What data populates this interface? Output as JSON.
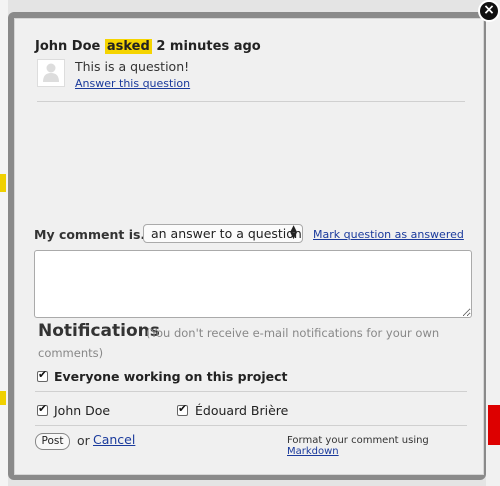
{
  "question": {
    "author": "John Doe",
    "action": "asked",
    "time": "2 minutes ago",
    "text": "This is a question!",
    "answer_link": "Answer this question"
  },
  "comment": {
    "label": "My comment is...",
    "type_selected": "an answer to a question",
    "mark_link": "Mark question as answered",
    "textarea_value": ""
  },
  "notifications": {
    "title": "Notifications",
    "note": "(You don't receive e-mail notifications for your own",
    "note_cont": "comments)",
    "everyone_label": "Everyone working on this project",
    "people": [
      {
        "name": "John Doe",
        "checked": true
      },
      {
        "name": "Édouard Brière",
        "checked": true
      }
    ]
  },
  "actions": {
    "post_label": "Post",
    "or_text": "or",
    "cancel_label": "Cancel",
    "format_text": "Format your comment using",
    "markdown_link": "Markdown"
  },
  "close_icon": "×",
  "colors": {
    "highlight": "#f5d400",
    "link": "#1a3a9c"
  }
}
